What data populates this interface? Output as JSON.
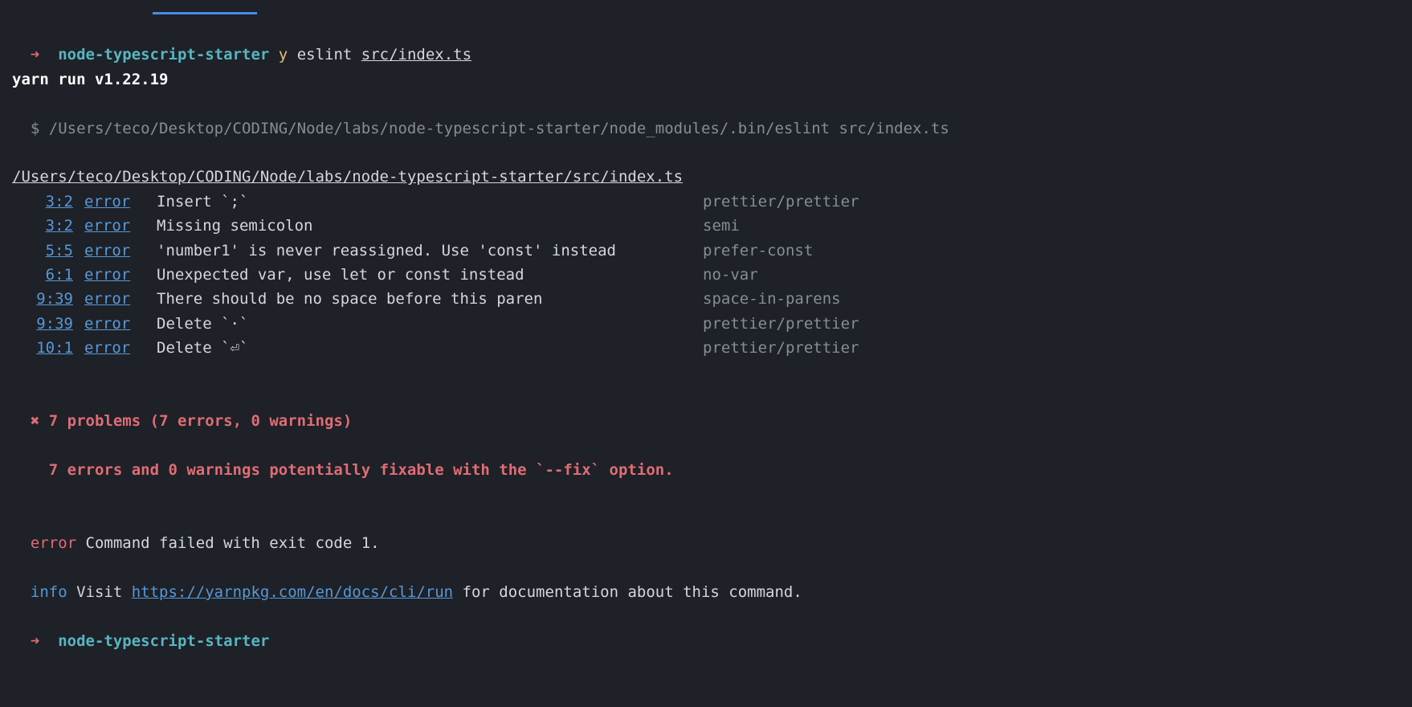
{
  "prompt1": {
    "arrow": "➜",
    "project": "node-typescript-starter",
    "cmd_prefix": "y",
    "cmd_name": "eslint",
    "cmd_arg": "src/index.ts"
  },
  "yarn_version_line": "yarn run v1.22.19",
  "exec_line": {
    "prefix": "$ ",
    "path": "/Users/teco/Desktop/CODING/Node/labs/node-typescript-starter/node_modules/.bin/eslint src/index.ts"
  },
  "file_path": "/Users/teco/Desktop/CODING/Node/labs/node-typescript-starter/src/index.ts",
  "lint_errors": [
    {
      "loc": "3:2",
      "level": "error",
      "message": "Insert `;`",
      "rule": "prettier/prettier"
    },
    {
      "loc": "3:2",
      "level": "error",
      "message": "Missing semicolon",
      "rule": "semi"
    },
    {
      "loc": "5:5",
      "level": "error",
      "message": "'number1' is never reassigned. Use 'const' instead",
      "rule": "prefer-const"
    },
    {
      "loc": "6:1",
      "level": "error",
      "message": "Unexpected var, use let or const instead",
      "rule": "no-var"
    },
    {
      "loc": "9:39",
      "level": "error",
      "message": "There should be no space before this paren",
      "rule": "space-in-parens"
    },
    {
      "loc": "9:39",
      "level": "error",
      "message": "Delete `·`",
      "rule": "prettier/prettier"
    },
    {
      "loc": "10:1",
      "level": "error",
      "message": "Delete `⏎`",
      "rule": "prettier/prettier"
    }
  ],
  "summary": {
    "icon": "✖",
    "line1": "7 problems (7 errors, 0 warnings)",
    "line2": "7 errors and 0 warnings potentially fixable with the `--fix` option."
  },
  "error_line": {
    "label": "error",
    "text": " Command failed with exit code 1."
  },
  "info_line": {
    "label": "info",
    "prefix": " Visit ",
    "url": "https://yarnpkg.com/en/docs/cli/run",
    "suffix": " for documentation about this command."
  },
  "prompt2": {
    "arrow": "➜",
    "project": "node-typescript-starter"
  }
}
